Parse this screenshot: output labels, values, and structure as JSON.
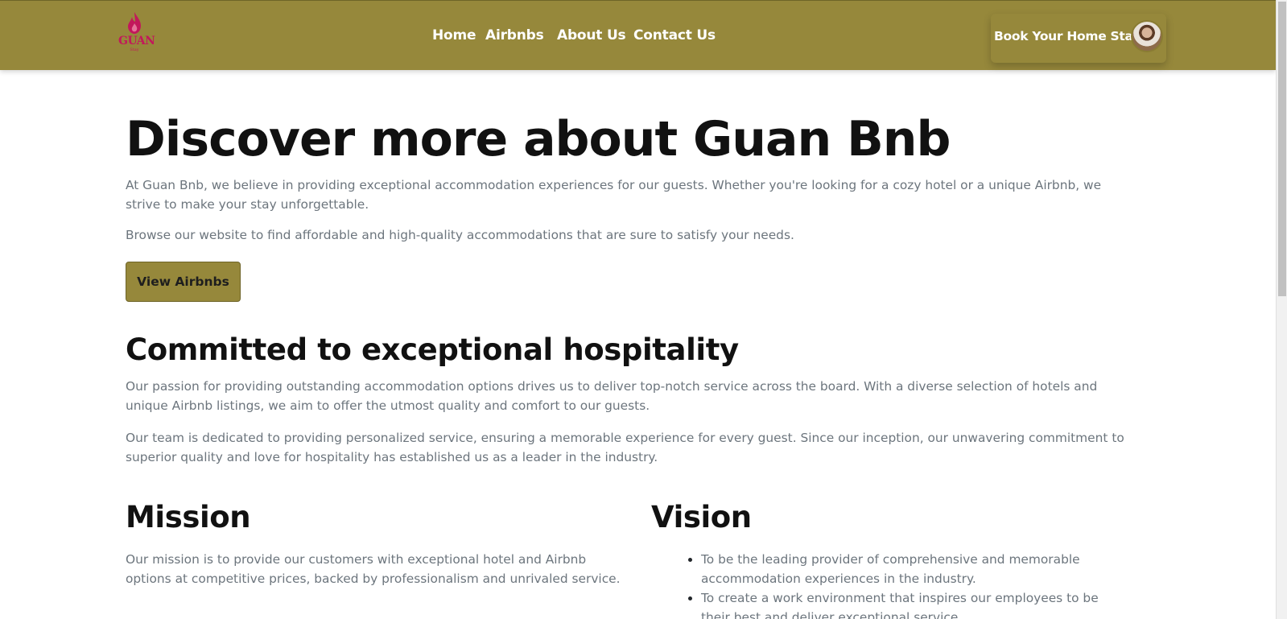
{
  "brand": {
    "name": "GUAN",
    "tagline": "Stay",
    "accent": "#96883b",
    "logo_color": "#c2185b",
    "logo_icon": "flame-icon"
  },
  "nav": {
    "links": [
      {
        "label": "Home"
      },
      {
        "label": "Airbnbs"
      },
      {
        "label": "About Us"
      },
      {
        "label": "Contact Us"
      }
    ],
    "cta_label": "Book Your Home Stay",
    "avatar_icon": "user-avatar-icon"
  },
  "hero": {
    "title": "Discover more about Guan Bnb",
    "paragraph1": "At Guan Bnb, we believe in providing exceptional accommodation experiences for our guests. Whether you're looking for a cozy hotel or a unique Airbnb, we strive to make your stay unforgettable.",
    "paragraph2": "Browse our website to find affordable and high-quality accommodations that are sure to satisfy your needs.",
    "button_label": "View Airbnbs"
  },
  "commitment": {
    "title": "Committed to exceptional hospitality",
    "paragraph1": "Our passion for providing outstanding accommodation options drives us to deliver top-notch service across the board. With a diverse selection of hotels and unique Airbnb listings, we aim to offer the utmost quality and comfort to our guests.",
    "paragraph2": "Our team is dedicated to providing personalized service, ensuring a memorable experience for every guest. Since our inception, our unwavering commitment to superior quality and love for hospitality has established us as a leader in the industry."
  },
  "mission": {
    "title": "Mission",
    "text": "Our mission is to provide our customers with exceptional hotel and Airbnb options at competitive prices, backed by professionalism and unrivaled service."
  },
  "vision": {
    "title": "Vision",
    "items": [
      "To be the leading provider of comprehensive and memorable accommodation experiences in the industry.",
      "To create a work environment that inspires our employees to be their best and deliver exceptional service."
    ]
  }
}
